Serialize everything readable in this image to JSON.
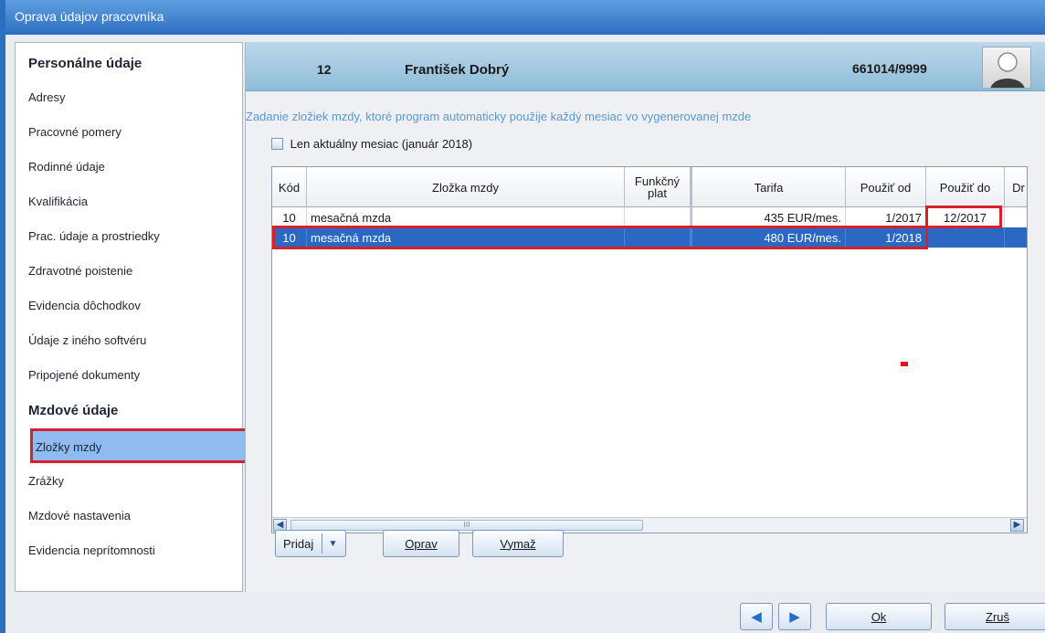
{
  "window": {
    "title": "Oprava údajov pracovníka"
  },
  "nav": {
    "section1": "Personálne údaje",
    "items1": [
      "Adresy",
      "Pracovné pomery",
      "Rodinné údaje",
      "Kvalifikácia",
      "Prac. údaje a prostriedky",
      "Zdravotné poistenie",
      "Evidencia dôchodkov",
      "Údaje z iného softvéru",
      "Pripojené dokumenty"
    ],
    "section2": "Mzdové údaje",
    "items2": [
      "Zložky mzdy",
      "Zrážky",
      "Mzdové nastavenia",
      "Evidencia neprítomnosti"
    ],
    "selected": "Zložky mzdy"
  },
  "employee": {
    "id": "12",
    "name": "František Dobrý",
    "personal_number": "661014/9999"
  },
  "description": "Zadanie zložiek mzdy, ktoré program automaticky použije každý mesiac vo vygenerovanej mzde",
  "filter": {
    "label": "Len aktuálny mesiac (január 2018)",
    "checked": false
  },
  "grid": {
    "columns": [
      "Kód",
      "Zložka mzdy",
      "Funkčný plat",
      "Tarifa",
      "Použiť od",
      "Použiť do",
      "Dr"
    ],
    "rows": [
      [
        "10",
        "mesačná mzda",
        "",
        "435 EUR/mes.",
        "1/2017",
        "12/2017",
        ""
      ],
      [
        "10",
        "mesačná mzda",
        "",
        "480 EUR/mes.",
        "1/2018",
        "",
        ""
      ]
    ],
    "selected_row": 1,
    "scroll_thumb_label": "III"
  },
  "buttons": {
    "add": "Pridaj",
    "edit": "Oprav",
    "delete": "Vymaž",
    "ok": "Ok",
    "cancel": "Zruš"
  },
  "icons": {
    "avatar": "person-avatar-icon",
    "dropdown": "chevron-down-icon",
    "prev": "arrow-left-icon",
    "next": "arrow-right-icon"
  }
}
